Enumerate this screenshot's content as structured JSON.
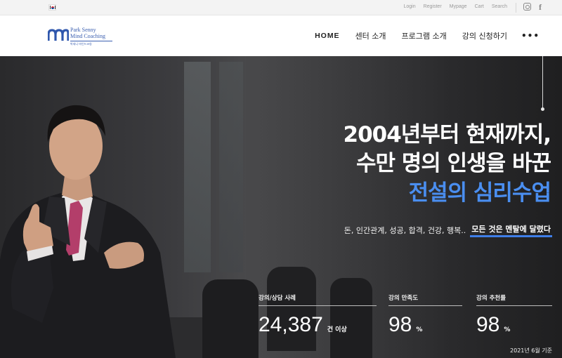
{
  "topbar": {
    "flag_icon": "korea-flag-icon",
    "links": [
      "Login",
      "Register",
      "Mypage",
      "Cart",
      "Search"
    ],
    "social": [
      "instagram-icon",
      "facebook-icon"
    ]
  },
  "logo": {
    "line1": "Park Senny",
    "line2": "Mind Coaching",
    "sub": "박세니 마인드코칭",
    "brand_color": "#3b5fb0"
  },
  "nav": {
    "items": [
      "HOME",
      "센터 소개",
      "프로그램 소개",
      "강의 신청하기"
    ],
    "more": "•••"
  },
  "hero": {
    "headline_line1": "2004년부터 현재까지,",
    "headline_line2": "수만 명의 인생을 바꾼",
    "headline_line3": "전설의 심리수업",
    "headline_accent_color": "#4a8ef0",
    "tagline_normal": "돈, 인간관계, 성공, 합격, 건강, 행복..",
    "tagline_emph": "모든 것은 멘탈에 달렸다",
    "stats": [
      {
        "label": "강의/상담 사례",
        "value": "24,387",
        "unit": "건 이상"
      },
      {
        "label": "강의 만족도",
        "value": "98",
        "unit": "%"
      },
      {
        "label": "강의 추천률",
        "value": "98",
        "unit": "%"
      }
    ],
    "as_of": "2021년 6월 기준"
  }
}
